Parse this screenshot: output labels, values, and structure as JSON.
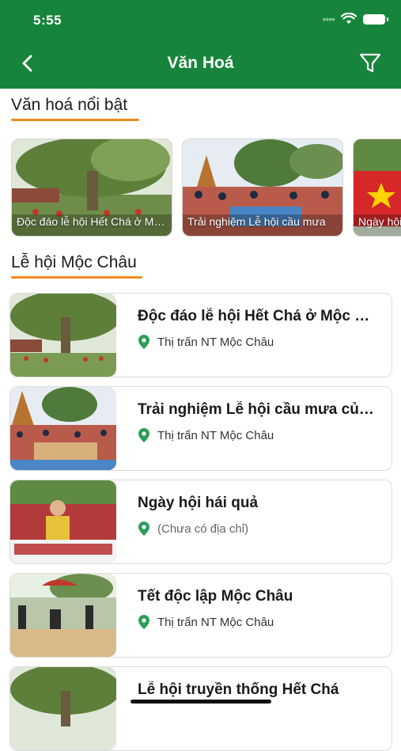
{
  "status_bar": {
    "time": "5:55"
  },
  "header": {
    "title": "Văn Hoá"
  },
  "sections": {
    "featured_title": "Văn hoá nổi bật",
    "list_title": "Lễ hội Mộc Châu"
  },
  "featured": [
    {
      "caption": "Độc đáo lễ hội Hết Chá ở Mộc Châu"
    },
    {
      "caption": "Trải nghiệm Lễ hội cầu mưa"
    },
    {
      "caption": "Ngày hội hái quả"
    }
  ],
  "list": [
    {
      "title": "Độc đáo lễ hội Hết Chá ở Mộc Châu",
      "location": "Thị trấn NT Mộc Châu"
    },
    {
      "title": "Trải nghiệm Lễ hội cầu mưa của người Mông",
      "location": "Thị trấn NT Mộc Châu"
    },
    {
      "title": "Ngày hội hái quả",
      "location": "(Chưa có địa chỉ)"
    },
    {
      "title": "Tết độc lập Mộc Châu",
      "location": "Thị trấn NT Mộc Châu"
    },
    {
      "title": "Lễ hội truyền thống Hết Chá",
      "location": ""
    }
  ],
  "colors": {
    "brand": "#16853b",
    "accent_underline": "#f08a1e",
    "pin": "#2e9e5b"
  },
  "icons": {
    "back": "chevron-left-icon",
    "filter": "filter-icon",
    "location": "map-pin-icon"
  }
}
